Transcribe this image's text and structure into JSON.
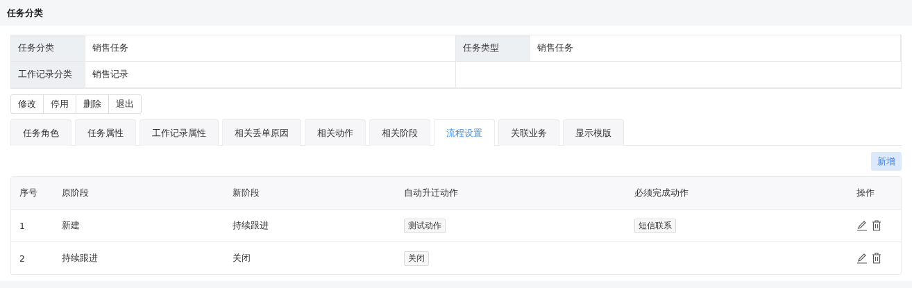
{
  "header": {
    "title": "任务分类"
  },
  "info": [
    {
      "label": "任务分类",
      "value": "销售任务"
    },
    {
      "label": "任务类型",
      "value": "销售任务"
    },
    {
      "label": "工作记录分类",
      "value": "销售记录"
    }
  ],
  "actions": [
    "修改",
    "停用",
    "删除",
    "退出"
  ],
  "tabs": [
    {
      "label": "任务角色",
      "selected": false
    },
    {
      "label": "任务属性",
      "selected": false
    },
    {
      "label": "工作记录属性",
      "selected": false
    },
    {
      "label": "相关丢单原因",
      "selected": false
    },
    {
      "label": "相关动作",
      "selected": false
    },
    {
      "label": "相关阶段",
      "selected": false
    },
    {
      "label": "流程设置",
      "selected": true
    },
    {
      "label": "关联业务",
      "selected": false
    },
    {
      "label": "显示模版",
      "selected": false
    }
  ],
  "add_button": "新增",
  "table": {
    "columns": [
      "序号",
      "原阶段",
      "新阶段",
      "自动升迁动作",
      "必须完成动作",
      "操作"
    ],
    "rows": [
      {
        "index": "1",
        "from": "新建",
        "to": "持续跟进",
        "auto_actions": [
          "测试动作"
        ],
        "required_actions": [
          "短信联系"
        ]
      },
      {
        "index": "2",
        "from": "持续跟进",
        "to": "关闭",
        "auto_actions": [
          "关闭"
        ],
        "required_actions": []
      }
    ]
  }
}
